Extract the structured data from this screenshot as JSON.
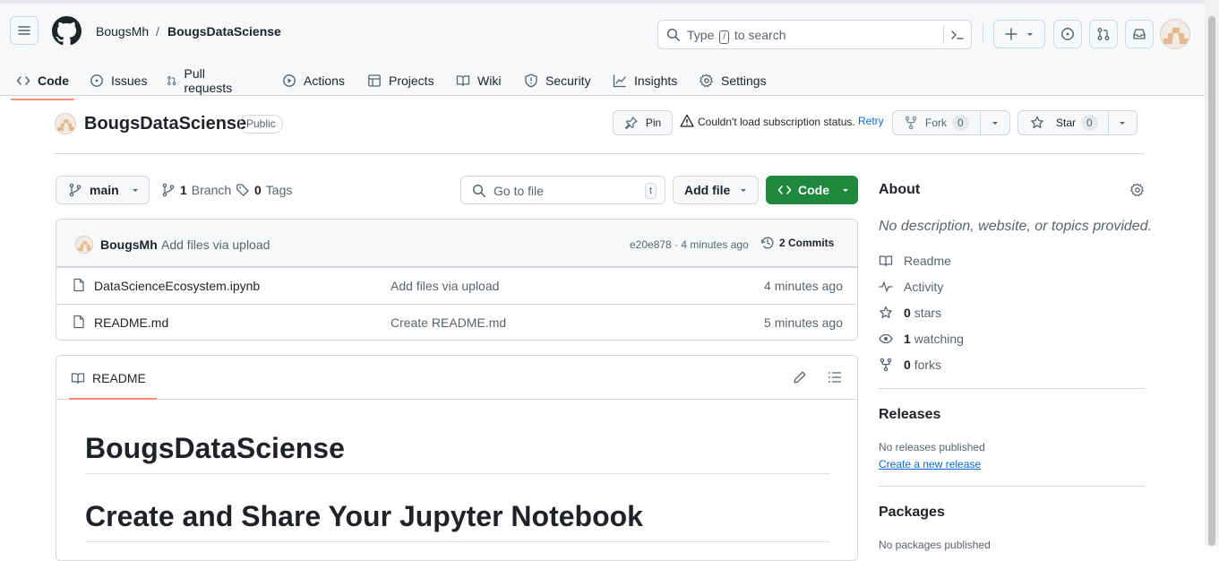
{
  "header": {
    "owner": "BougsMh",
    "separator": "/",
    "repo": "BougsDataSciense",
    "search_placeholder_prefix": "Type",
    "search_key": "/",
    "search_placeholder_suffix": "to search"
  },
  "tabs": [
    {
      "label": "Code",
      "icon": "code-icon",
      "selected": true
    },
    {
      "label": "Issues",
      "icon": "issue-icon"
    },
    {
      "label": "Pull requests",
      "icon": "pull-request-icon"
    },
    {
      "label": "Actions",
      "icon": "play-icon"
    },
    {
      "label": "Projects",
      "icon": "table-icon"
    },
    {
      "label": "Wiki",
      "icon": "book-icon"
    },
    {
      "label": "Security",
      "icon": "shield-icon"
    },
    {
      "label": "Insights",
      "icon": "graph-icon"
    },
    {
      "label": "Settings",
      "icon": "gear-icon"
    }
  ],
  "repo_head": {
    "name": "BougsDataSciense",
    "visibility": "Public",
    "pin_label": "Pin",
    "subscription_error": "Couldn't load subscription status.",
    "retry_label": "Retry",
    "fork_label": "Fork",
    "fork_count": "0",
    "star_label": "Star",
    "star_count": "0"
  },
  "toolbar": {
    "branch": "main",
    "branch_count": "1",
    "branch_label": "Branch",
    "tag_count": "0",
    "tag_label": "Tags",
    "goto_placeholder": "Go to file",
    "goto_key": "t",
    "add_file_label": "Add file",
    "code_label": "Code"
  },
  "commit": {
    "author": "BougsMh",
    "message": "Add files via upload",
    "hash_time": "e20e878 · 4 minutes ago",
    "commit_count": "2 Commits"
  },
  "files": [
    {
      "name": "DataScienceEcosystem.ipynb",
      "message": "Add files via upload",
      "time": "4 minutes ago"
    },
    {
      "name": "README.md",
      "message": "Create README.md",
      "time": "5 minutes ago"
    }
  ],
  "readme": {
    "tab_label": "README",
    "h1": "BougsDataSciense",
    "h2": "Create and Share Your Jupyter Notebook"
  },
  "about": {
    "title": "About",
    "description": "No description, website, or topics provided.",
    "readme": "Readme",
    "activity": "Activity",
    "stars_count": "0",
    "stars_label": "stars",
    "watching_count": "1",
    "watching_label": "watching",
    "forks_count": "0",
    "forks_label": "forks"
  },
  "releases": {
    "title": "Releases",
    "none": "No releases published",
    "create_link": "Create a new release"
  },
  "packages": {
    "title": "Packages",
    "none": "No packages published"
  },
  "colors": {
    "accent_tab": "#fd8c73",
    "code_button": "#1f883d",
    "link": "#0969da"
  }
}
